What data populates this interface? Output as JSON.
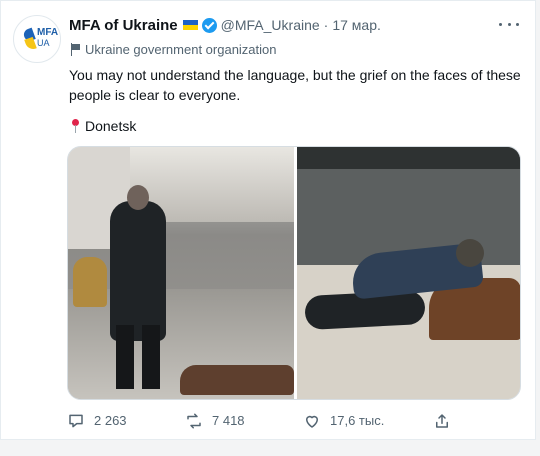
{
  "tweet": {
    "author": {
      "name": "MFA of Ukraine",
      "handle": "@MFA_Ukraine",
      "separator": "·",
      "date": "17 мар.",
      "avatar_text": "MFA",
      "avatar_subtext": "UA",
      "organization": "Ukraine government organization"
    },
    "text": "You may not understand the language, but the grief on the faces of these people is clear to everyone.",
    "location": "Donetsk",
    "counts": {
      "replies": "2 263",
      "retweets": "7 418",
      "likes": "17,6 тыс."
    }
  },
  "icons": {
    "more": "more-icon",
    "reply": "reply-icon",
    "retweet": "retweet-icon",
    "like": "like-icon",
    "share": "share-icon"
  },
  "colors": {
    "accent": "#1d9bf0",
    "text": "#0f1419",
    "secondary": "#536471",
    "flag_blue": "#1f63c6",
    "flag_yellow": "#ffd500"
  }
}
